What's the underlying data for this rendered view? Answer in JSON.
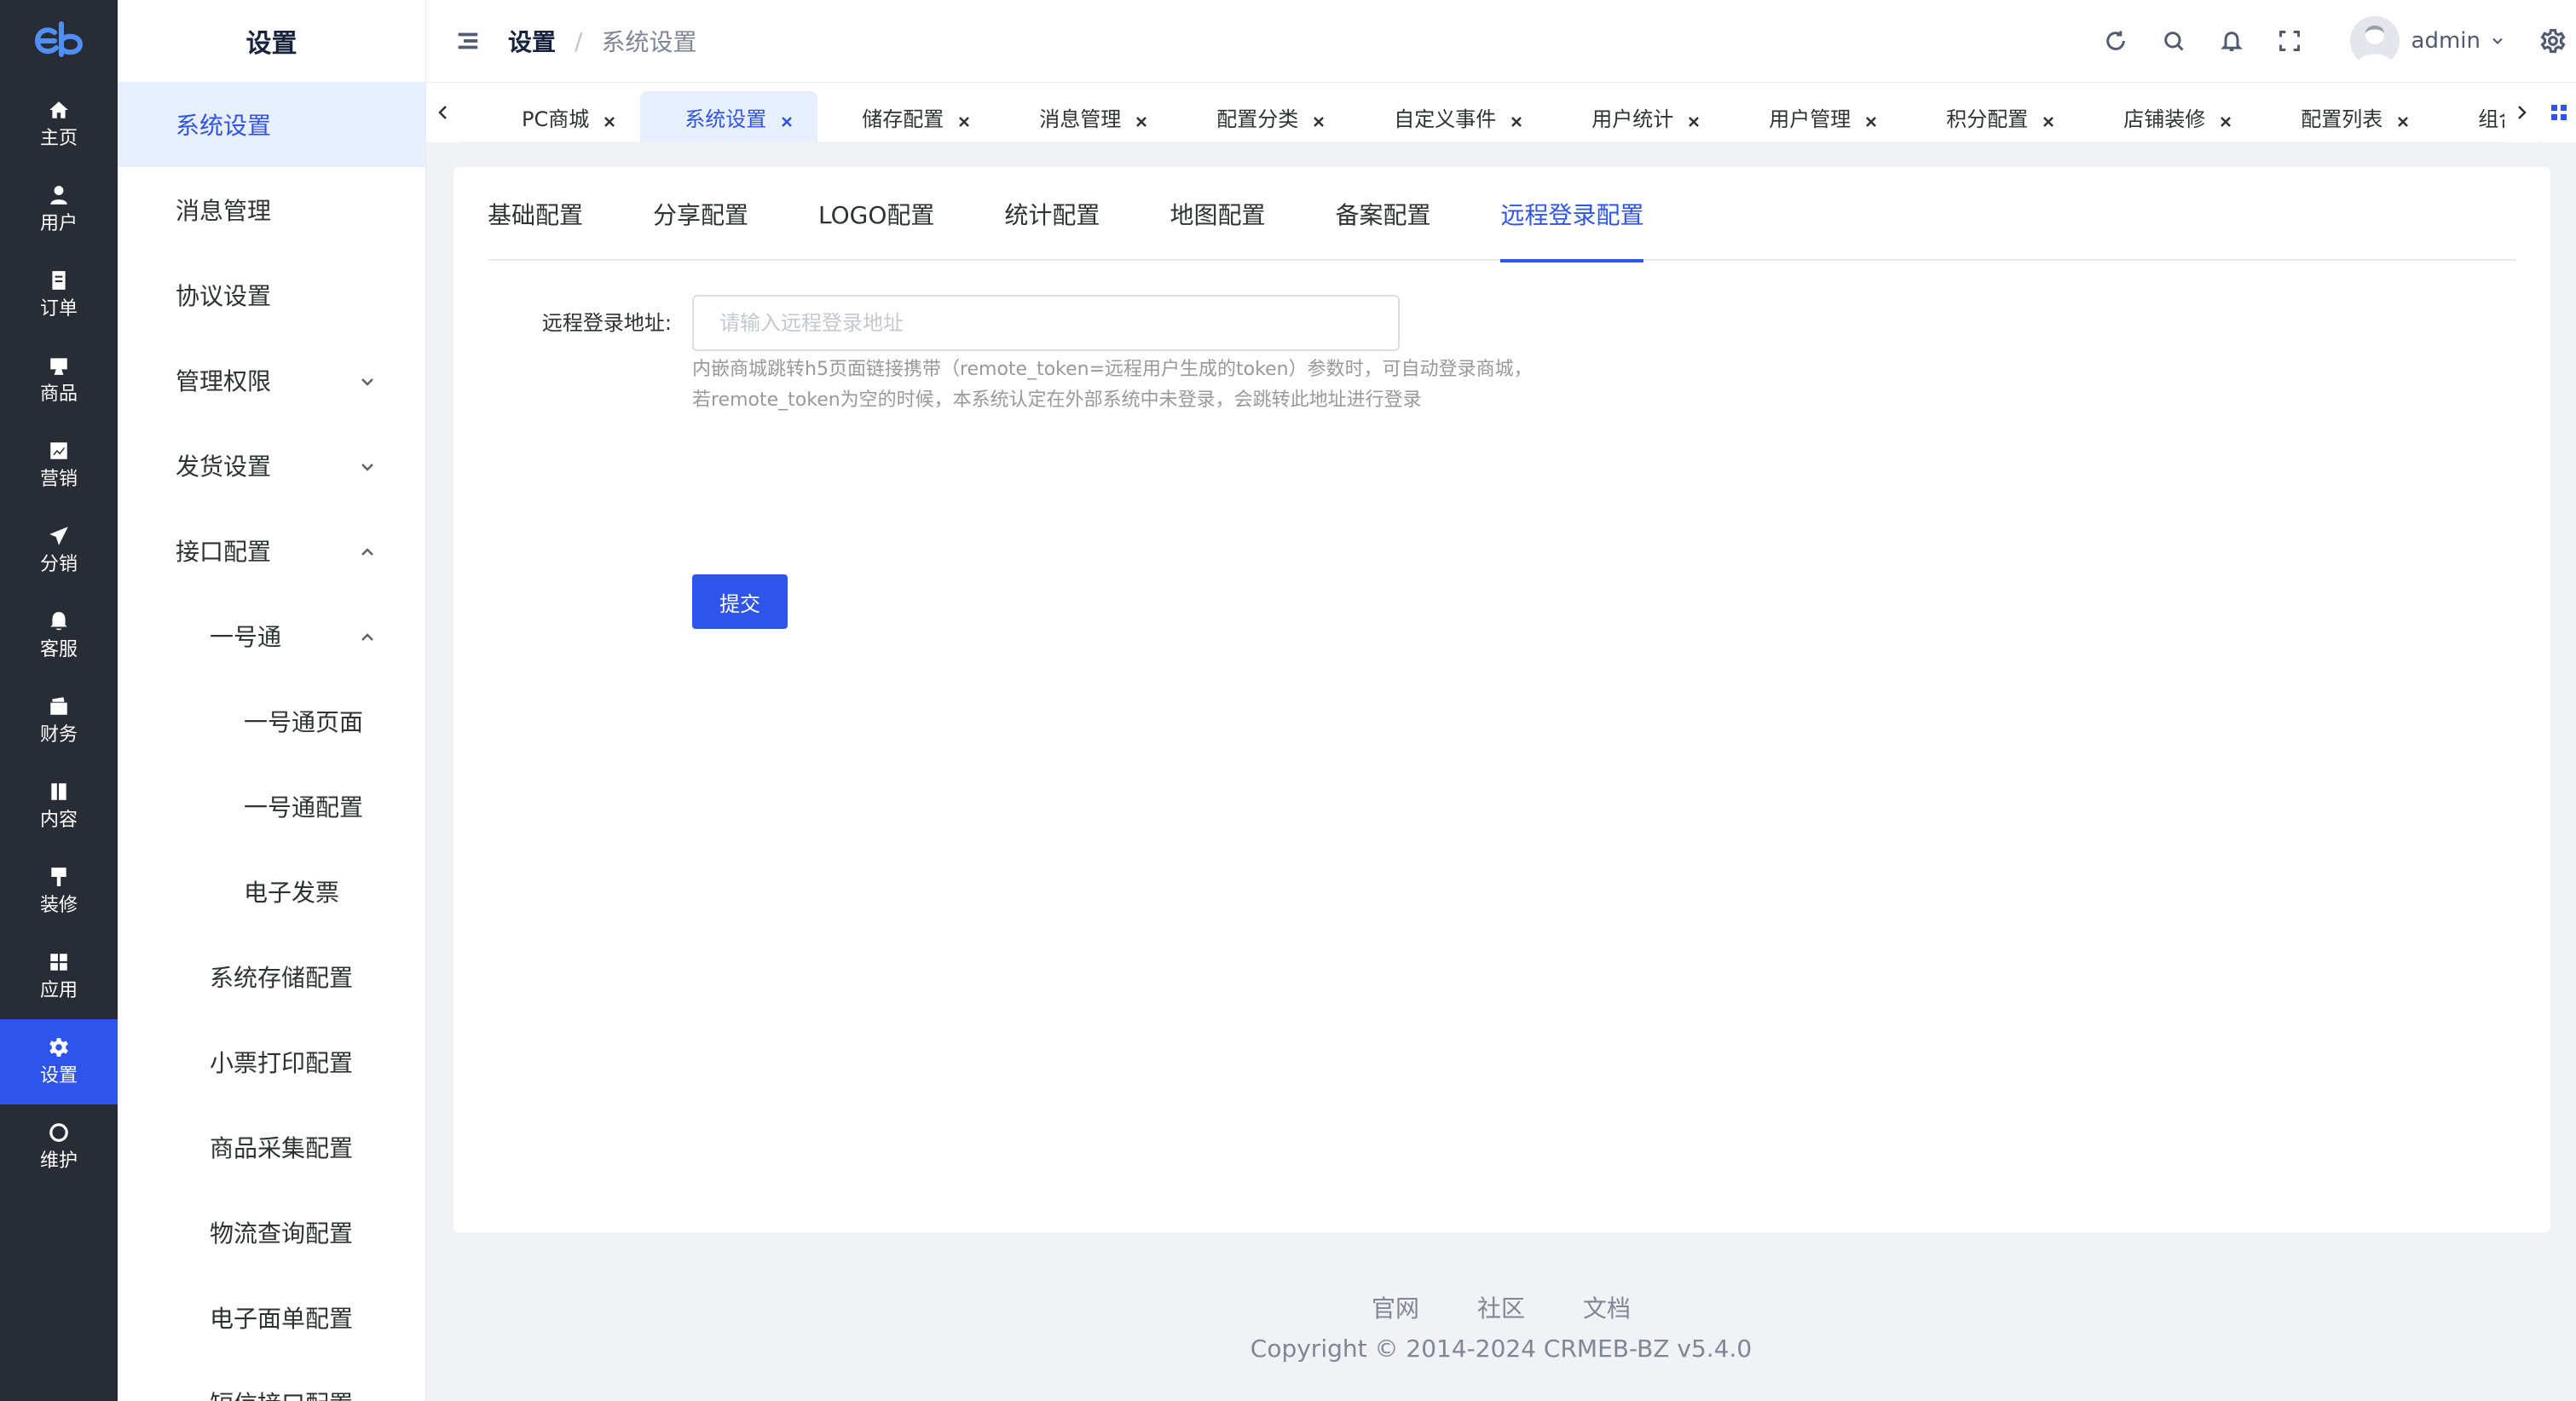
{
  "brand": {
    "logo_text": "eb",
    "accent": "#2f54eb"
  },
  "rail": [
    {
      "label": "主页",
      "icon": "home-icon"
    },
    {
      "label": "用户",
      "icon": "user-icon"
    },
    {
      "label": "订单",
      "icon": "order-icon"
    },
    {
      "label": "商品",
      "icon": "product-icon"
    },
    {
      "label": "营销",
      "icon": "marketing-icon"
    },
    {
      "label": "分销",
      "icon": "send-icon"
    },
    {
      "label": "客服",
      "icon": "bell-icon"
    },
    {
      "label": "财务",
      "icon": "wallet-icon"
    },
    {
      "label": "内容",
      "icon": "book-icon"
    },
    {
      "label": "装修",
      "icon": "brush-icon"
    },
    {
      "label": "应用",
      "icon": "apps-icon"
    },
    {
      "label": "设置",
      "icon": "gear-icon"
    },
    {
      "label": "维护",
      "icon": "maintenance-icon"
    }
  ],
  "sidebar": {
    "title": "设置",
    "items": [
      {
        "label": "系统设置"
      },
      {
        "label": "消息管理"
      },
      {
        "label": "协议设置"
      },
      {
        "label": "管理权限"
      },
      {
        "label": "发货设置"
      },
      {
        "label": "接口配置"
      },
      {
        "label": "一号通"
      },
      {
        "label": "一号通页面"
      },
      {
        "label": "一号通配置"
      },
      {
        "label": "电子发票"
      },
      {
        "label": "系统存储配置"
      },
      {
        "label": "小票打印配置"
      },
      {
        "label": "商品采集配置"
      },
      {
        "label": "物流查询配置"
      },
      {
        "label": "电子面单配置"
      },
      {
        "label": "短信接口配置"
      }
    ]
  },
  "header": {
    "breadcrumb": [
      "设置",
      "系统设置"
    ],
    "separator": "/",
    "user_name": "admin"
  },
  "tags": [
    {
      "label": "PC商城"
    },
    {
      "label": "系统设置"
    },
    {
      "label": "储存配置"
    },
    {
      "label": "消息管理"
    },
    {
      "label": "配置分类"
    },
    {
      "label": "自定义事件"
    },
    {
      "label": "用户统计"
    },
    {
      "label": "用户管理"
    },
    {
      "label": "积分配置"
    },
    {
      "label": "店铺装修"
    },
    {
      "label": "配置列表"
    },
    {
      "label": "组合数据"
    }
  ],
  "content_tabs": [
    {
      "label": "基础配置"
    },
    {
      "label": "分享配置"
    },
    {
      "label": "LOGO配置"
    },
    {
      "label": "统计配置"
    },
    {
      "label": "地图配置"
    },
    {
      "label": "备案配置"
    },
    {
      "label": "远程登录配置"
    }
  ],
  "form": {
    "label": "远程登录地址:",
    "placeholder": "请输入远程登录地址",
    "value": "",
    "tip_line1": "内嵌商城跳转h5页面链接携带（remote_token=远程用户生成的token）参数时，可自动登录商城，",
    "tip_line2": "若remote_token为空的时候，本系统认定在外部系统中未登录，会跳转此地址进行登录",
    "submit_label": "提交"
  },
  "footer": {
    "links": [
      "官网",
      "社区",
      "文档"
    ],
    "copyright": "Copyright © 2014-2024 CRMEB-BZ v5.4.0"
  }
}
